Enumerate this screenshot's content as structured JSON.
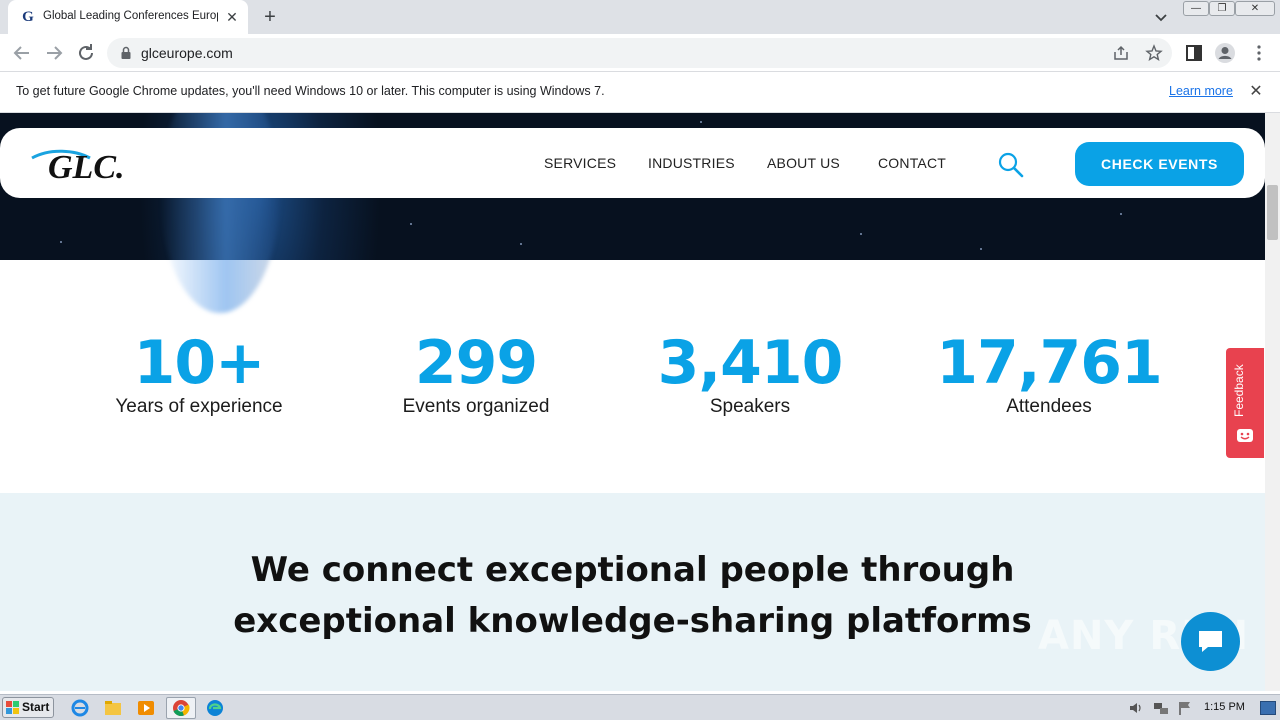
{
  "browser": {
    "tab": {
      "title": "Global Leading Conferences Europe",
      "favicon": "G"
    },
    "new_tab": "+",
    "url": "glceurope.com",
    "info_bar": {
      "message": "To get future Google Chrome updates, you'll need Windows 10 or later. This computer is using Windows 7.",
      "learn_more": "Learn more"
    }
  },
  "site": {
    "logo_text": "GLC.",
    "nav": {
      "items": [
        "SERVICES",
        "INDUSTRIES",
        "ABOUT US",
        "CONTACT"
      ],
      "cta": "CHECK EVENTS"
    },
    "stats": [
      {
        "value": "10+",
        "label": "Years of experience"
      },
      {
        "value": "299",
        "label": "Events organized"
      },
      {
        "value": "3,410",
        "label": "Speakers"
      },
      {
        "value": "17,761",
        "label": "Attendees"
      }
    ],
    "headline_line1": "We connect exceptional people through",
    "headline_line2": "exceptional knowledge-sharing platforms",
    "feedback_label": "Feedback",
    "accent_color": "#0aa2e6",
    "feedback_color": "#e8424f"
  },
  "watermark": "ANY RUN",
  "taskbar": {
    "start_label": "Start",
    "clock": "1:15 PM"
  }
}
